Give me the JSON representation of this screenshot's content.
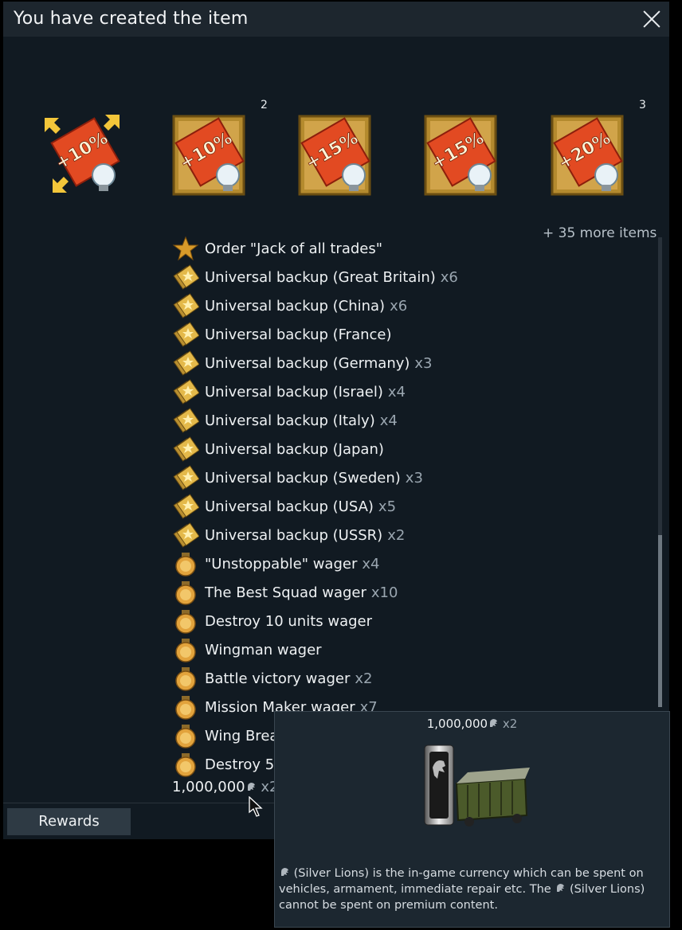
{
  "window": {
    "title": "You have created the item",
    "close_icon": "close-icon"
  },
  "items_top": [
    {
      "label": "+10%",
      "style": "arrows",
      "count": ""
    },
    {
      "label": "+10%",
      "style": "framed",
      "count": "2"
    },
    {
      "label": "+15%",
      "style": "framed",
      "count": ""
    },
    {
      "label": "+15%",
      "style": "framed",
      "count": ""
    },
    {
      "label": "+20%",
      "style": "framed",
      "count": "3"
    }
  ],
  "more_items": "+ 35 more items",
  "list": [
    {
      "icon": "star-icon",
      "name": "Order \"Jack of all trades\"",
      "count": ""
    },
    {
      "icon": "backup-icon",
      "name": "Universal backup (Great Britain)",
      "count": "x6"
    },
    {
      "icon": "backup-icon",
      "name": "Universal backup (China)",
      "count": "x6"
    },
    {
      "icon": "backup-icon",
      "name": "Universal backup (France)",
      "count": ""
    },
    {
      "icon": "backup-icon",
      "name": "Universal backup (Germany)",
      "count": "x3"
    },
    {
      "icon": "backup-icon",
      "name": "Universal backup (Israel)",
      "count": "x4"
    },
    {
      "icon": "backup-icon",
      "name": "Universal backup (Italy)",
      "count": "x4"
    },
    {
      "icon": "backup-icon",
      "name": "Universal backup (Japan)",
      "count": ""
    },
    {
      "icon": "backup-icon",
      "name": "Universal backup (Sweden)",
      "count": "x3"
    },
    {
      "icon": "backup-icon",
      "name": "Universal backup (USA)",
      "count": "x5"
    },
    {
      "icon": "backup-icon",
      "name": "Universal backup (USSR)",
      "count": "x2"
    },
    {
      "icon": "wager-icon",
      "name": "\"Unstoppable\" wager",
      "count": "x4"
    },
    {
      "icon": "wager-icon",
      "name": "The Best Squad wager",
      "count": "x10"
    },
    {
      "icon": "wager-icon",
      "name": "Destroy 10 units wager",
      "count": ""
    },
    {
      "icon": "wager-icon",
      "name": "Wingman wager",
      "count": ""
    },
    {
      "icon": "wager-icon",
      "name": "Battle victory wager",
      "count": "x2"
    },
    {
      "icon": "wager-icon",
      "name": "Mission Maker wager",
      "count": "x7"
    },
    {
      "icon": "wager-icon",
      "name": "Wing Breal",
      "count": ""
    },
    {
      "icon": "wager-icon",
      "name": "Destroy 5",
      "count": ""
    }
  ],
  "money": {
    "amount": "1,000,000",
    "count": "x2",
    "icon": "silver-lion-icon"
  },
  "rewards_button": "Rewards",
  "tooltip": {
    "amount": "1,000,000",
    "count": "x2",
    "image": "silver-lions-wagon",
    "desc_1": "(Silver Lions) is the in-game currency which can be spent on vehicles, armament, immediate repair etc. The",
    "desc_2": "(Silver Lions) cannot be spent on premium content."
  },
  "colors": {
    "background": "#111a22",
    "titlebar": "#1d262e",
    "count_gray": "#9aa6b0",
    "accent_orange": "#e8472a",
    "gold": "#c9a43a"
  }
}
